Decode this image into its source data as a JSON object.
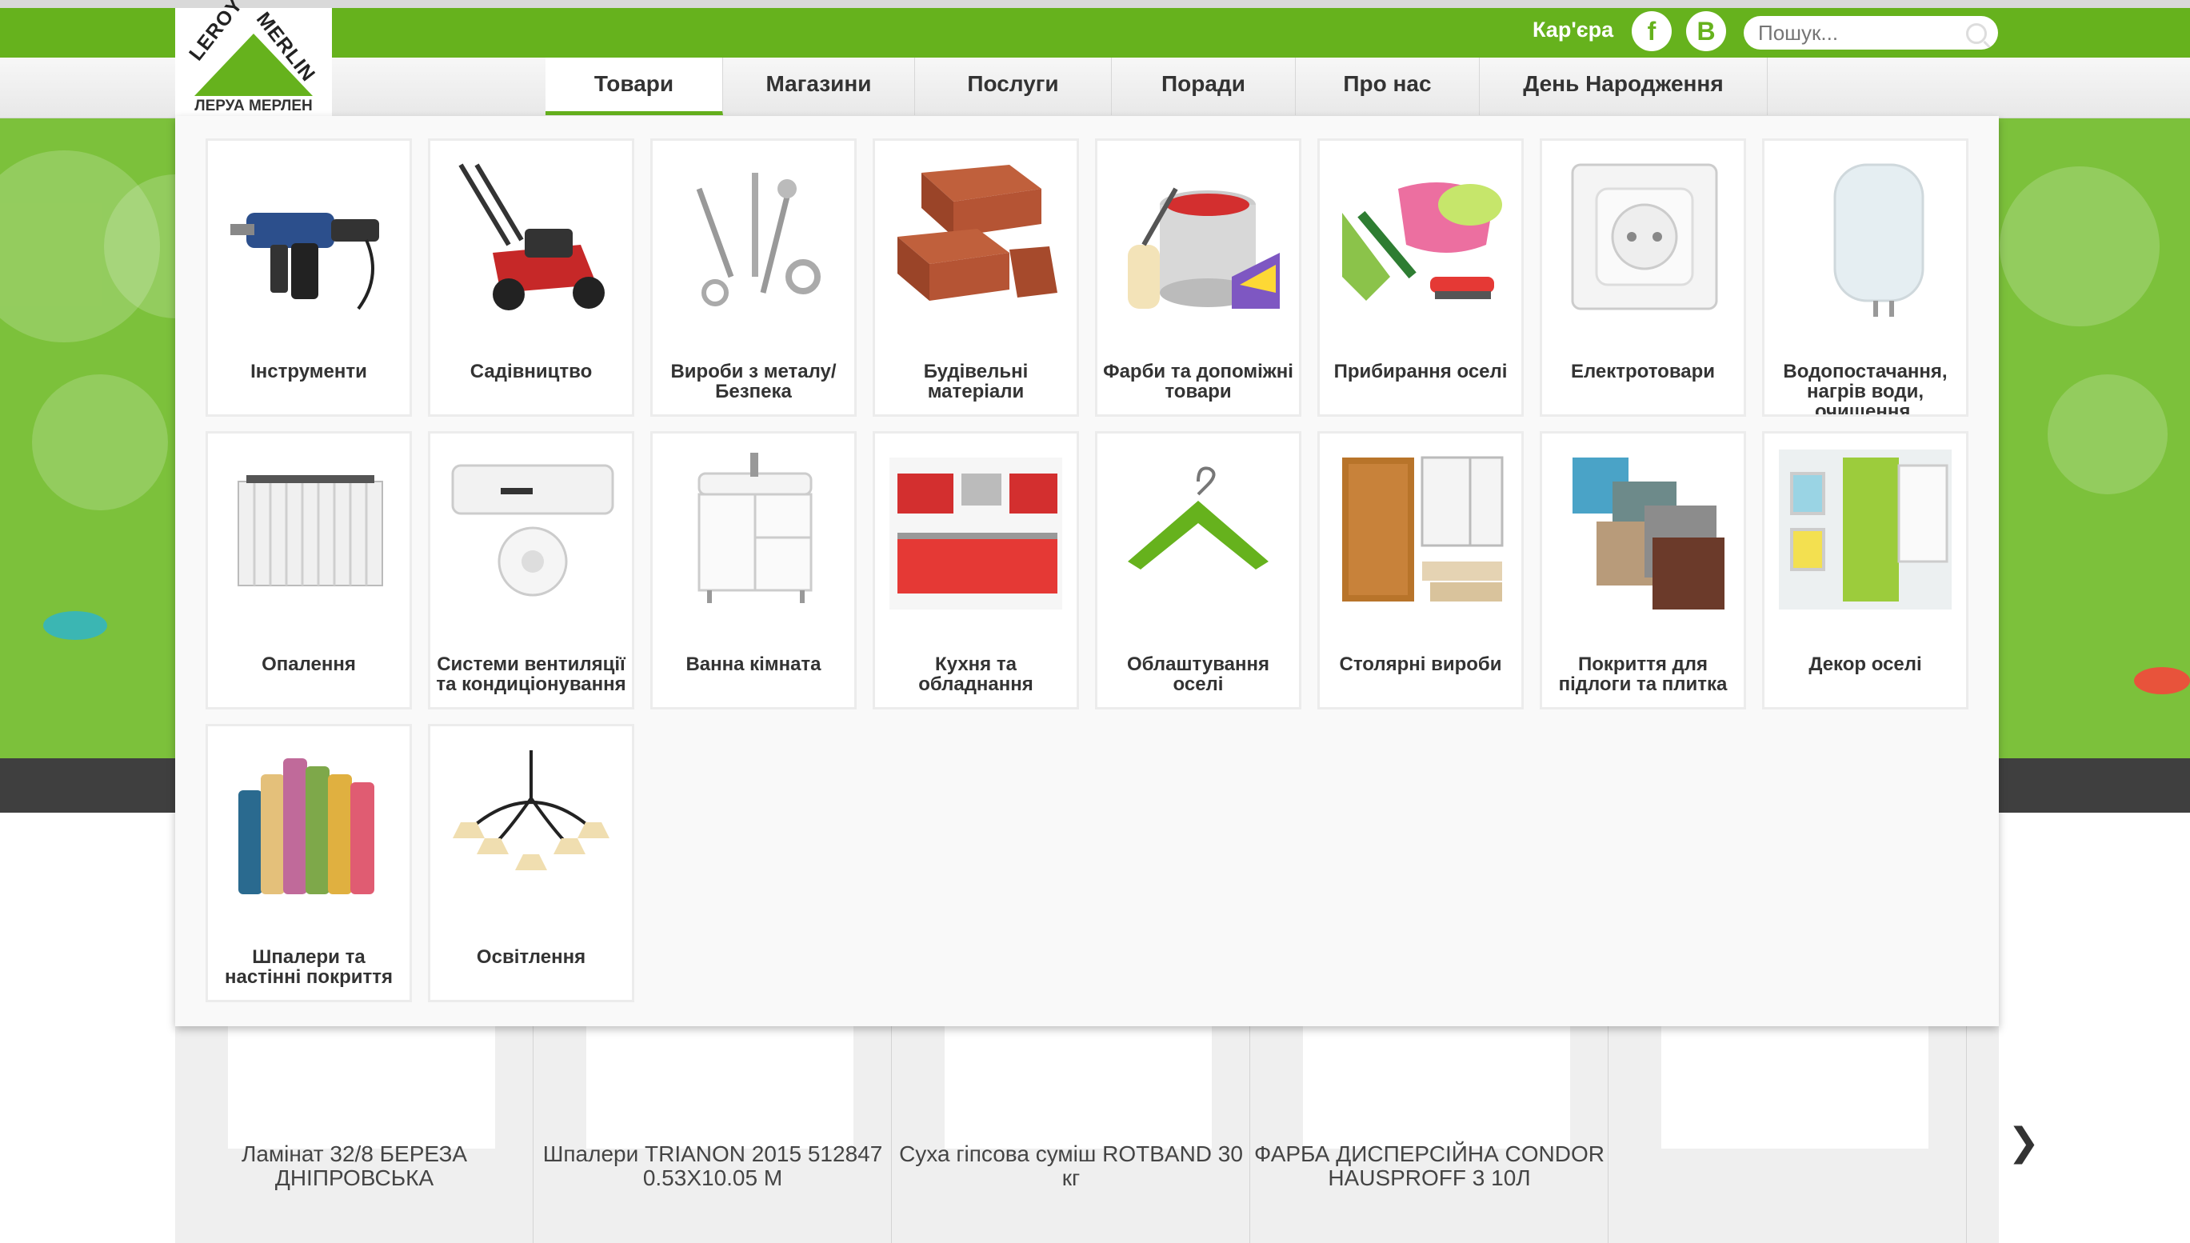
{
  "topbar": {
    "career": "Кар'єра",
    "facebook_glyph": "f",
    "vk_glyph": "B",
    "search_placeholder": "Пошук..."
  },
  "logo": {
    "word1": "LEROY",
    "word2": "MERLIN",
    "cyrillic": "ЛЕРУА МЕРЛЕН"
  },
  "nav": {
    "items": [
      "Товари",
      "Магазини",
      "Послуги",
      "Поради",
      "Про нас",
      "День Народження"
    ],
    "active_index": 0
  },
  "colors": {
    "brand_green": "#66b21d",
    "hero_green": "#7cc13b"
  },
  "menu": {
    "categories": [
      {
        "label": "Інструменти",
        "icon": "drill-icon"
      },
      {
        "label": "Садівництво",
        "icon": "lawnmower-icon"
      },
      {
        "label": "Вироби з металу/Безпека",
        "icon": "screws-icon"
      },
      {
        "label": "Будівельні матеріали",
        "icon": "bricks-icon"
      },
      {
        "label": "Фарби та допоміжні товари",
        "icon": "paint-can-icon"
      },
      {
        "label": "Прибирання оселі",
        "icon": "cleaning-icon"
      },
      {
        "label": "Електротовари",
        "icon": "socket-icon"
      },
      {
        "label": "Водопостачання, нагрів води, очищення, каналізація",
        "icon": "boiler-icon"
      },
      {
        "label": "Опалення",
        "icon": "radiator-icon"
      },
      {
        "label": "Системи вентиляції та кондиціонування",
        "icon": "air-conditioner-icon"
      },
      {
        "label": "Ванна кімната",
        "icon": "vanity-icon"
      },
      {
        "label": "Кухня та обладнання",
        "icon": "kitchen-icon"
      },
      {
        "label": "Облаштування оселі",
        "icon": "hanger-icon"
      },
      {
        "label": "Столярні вироби",
        "icon": "door-icon"
      },
      {
        "label": "Покриття для підлоги та плитка",
        "icon": "tiles-icon"
      },
      {
        "label": "Декор оселі",
        "icon": "curtain-icon"
      },
      {
        "label": "Шпалери та настінні покриття",
        "icon": "wallpaper-rolls-icon"
      },
      {
        "label": "Освітлення",
        "icon": "chandelier-icon"
      }
    ]
  },
  "carousel": {
    "products": [
      {
        "name": "Ламінат 32/8 БЕРЕЗА ДНІПРОВСЬКА"
      },
      {
        "name": "Шпалери TRIANON 2015 512847 0.53X10.05 М"
      },
      {
        "name": "Суха гіпсова суміш ROTBAND 30 кг"
      },
      {
        "name": "ФАРБА ДИСПЕРСІЙНА CONDOR HAUSPROFF 3 10Л"
      },
      {
        "name": ""
      }
    ],
    "next_arrow": "❯"
  }
}
